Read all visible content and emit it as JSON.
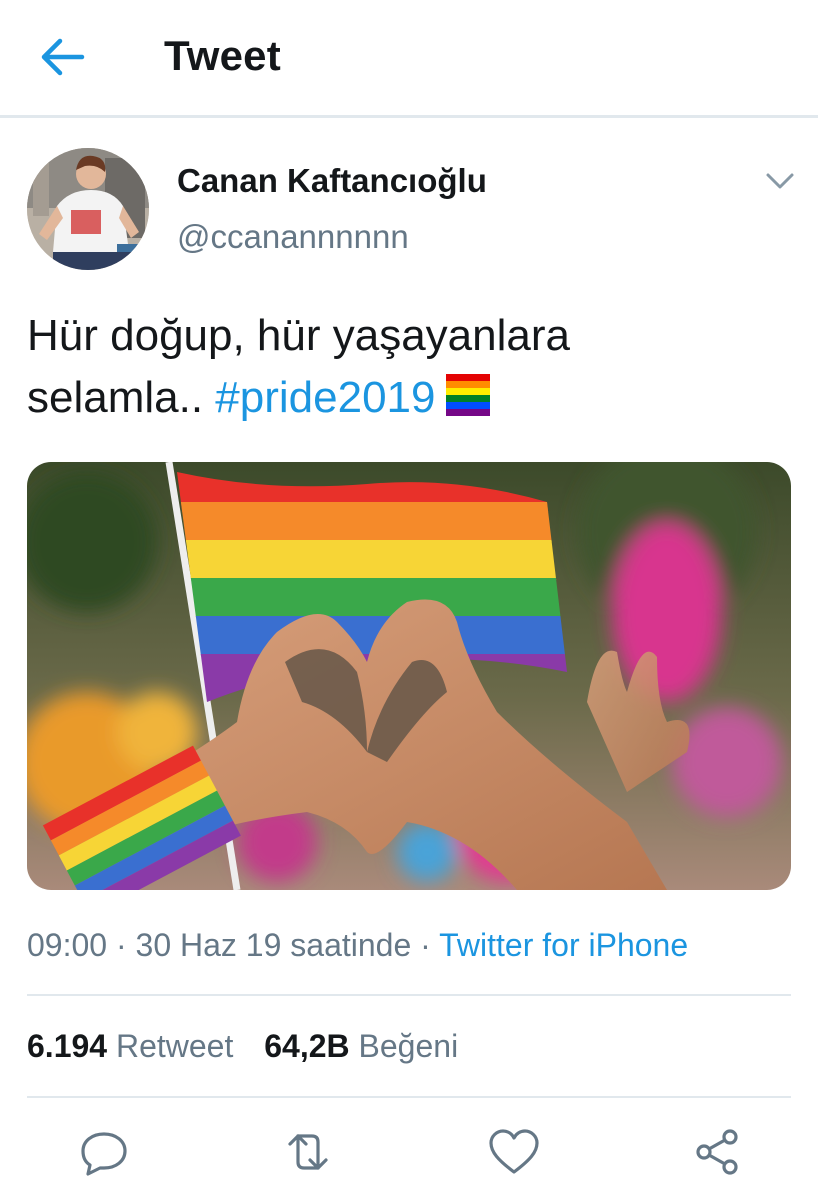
{
  "header": {
    "title": "Tweet",
    "back_icon": "arrow-left-icon"
  },
  "tweet": {
    "author": {
      "display_name": "Canan Kaftancıoğlu",
      "handle": "@ccanannnnnn"
    },
    "text_line1": "Hür doğup, hür yaşayanlara",
    "text_line2": "selamla.. ",
    "hashtag": "#pride2019",
    "emoji": "rainbow-flag-icon",
    "timestamp": "09:00 · 30 Haz 19 saatinde · ",
    "source": "Twitter for iPhone",
    "stats": {
      "retweets_count": "6.194",
      "retweets_label": "Retweet",
      "likes_count": "64,2B",
      "likes_label": "Beğeni"
    }
  },
  "actions": [
    {
      "icon": "reply-icon"
    },
    {
      "icon": "retweet-icon"
    },
    {
      "icon": "like-icon"
    },
    {
      "icon": "share-icon"
    }
  ],
  "colors": {
    "accent": "#1b95e0",
    "text": "#14171a",
    "secondary": "#657786",
    "divider": "#e1e8ed"
  }
}
